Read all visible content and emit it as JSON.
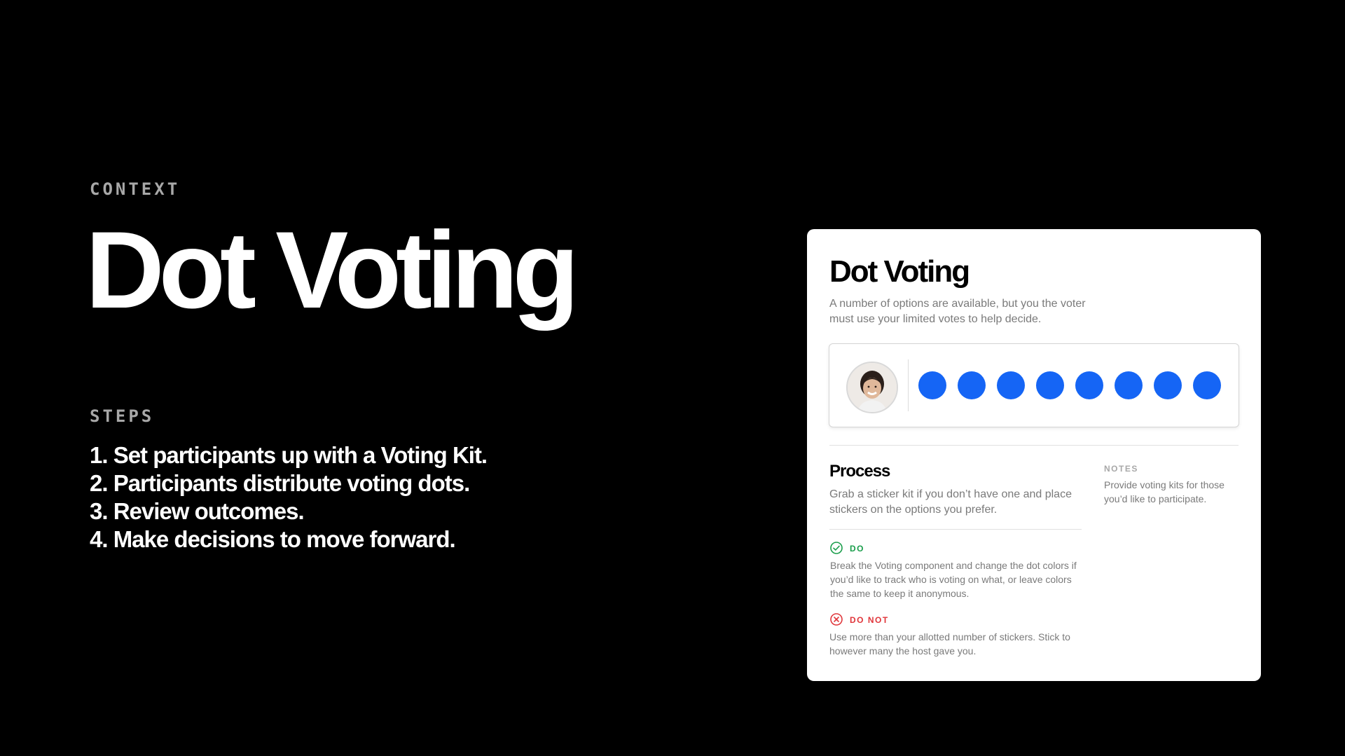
{
  "left": {
    "context_label": "CONTEXT",
    "title": "Dot Voting",
    "steps_label": "STEPS",
    "steps": [
      "1. Set participants up with a Voting Kit.",
      "2. Participants distribute voting dots.",
      "3. Review outcomes.",
      "4. Make decisions to move forward."
    ]
  },
  "card": {
    "title": "Dot Voting",
    "description": "A number of options are available, but you the voter must use your limited votes to help decide.",
    "voting": {
      "avatar_icon": "person-avatar",
      "dot_count": 8,
      "dot_color": "#1565f5"
    },
    "process": {
      "title": "Process",
      "description": "Grab a sticker kit if you don’t have one and place stickers on the options you prefer."
    },
    "notes": {
      "label": "NOTES",
      "text": "Provide voting kits for those you’d like to participate."
    },
    "do": {
      "icon": "check-circle-icon",
      "label": "DO",
      "color": "#1a9e4b",
      "text": "Break the Voting component and change the dot colors if you’d like to track who is voting on what, or leave colors the same to keep it anonymous."
    },
    "do_not": {
      "icon": "x-circle-icon",
      "label": "DO NOT",
      "color": "#e0363b",
      "text": "Use more than your allotted number of stickers. Stick to however many the host gave you."
    }
  }
}
